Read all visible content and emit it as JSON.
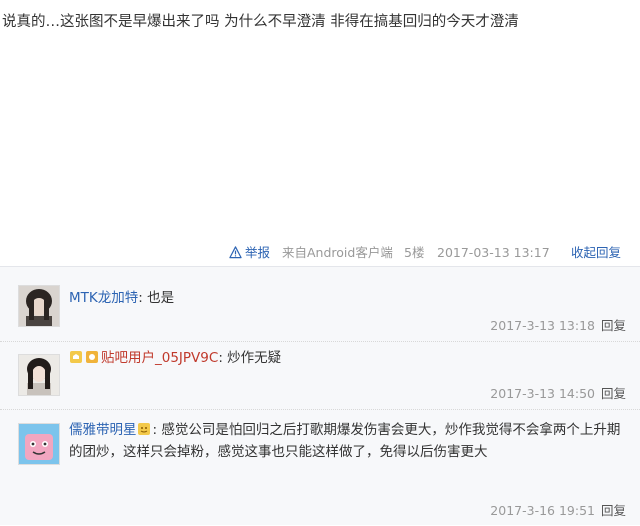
{
  "post": {
    "text": "说真的…这张图不是早爆出来了吗 为什么不早澄清 非得在搞基回归的今天才澄清",
    "report_label": "举报",
    "client": "来自Android客户端",
    "floor": "5楼",
    "timestamp": "2017-03-13 13:17",
    "collapse_label": "收起回复"
  },
  "replies": [
    {
      "username": "MTK龙加特",
      "separator": ": ",
      "text": "也是",
      "time": "2017-3-13 13:18",
      "reply_label": "回复"
    },
    {
      "username": "贴吧用户_05JPV9C",
      "separator": ": ",
      "text": "炒作无疑",
      "time": "2017-3-13 14:50",
      "reply_label": "回复"
    },
    {
      "username": "儒雅带明星",
      "separator": ": ",
      "text": "感觉公司是怕回归之后打歌期爆发伤害会更大，炒作我觉得不会拿两个上升期的团炒，这样只会掉粉，感觉这事也只能这样做了，免得以后伤害更大",
      "time": "2017-3-16 19:51",
      "reply_label": "回复"
    }
  ],
  "colors": {
    "link": "#2d64b3",
    "meta": "#999999",
    "panel_bg": "#f7f8fa"
  }
}
